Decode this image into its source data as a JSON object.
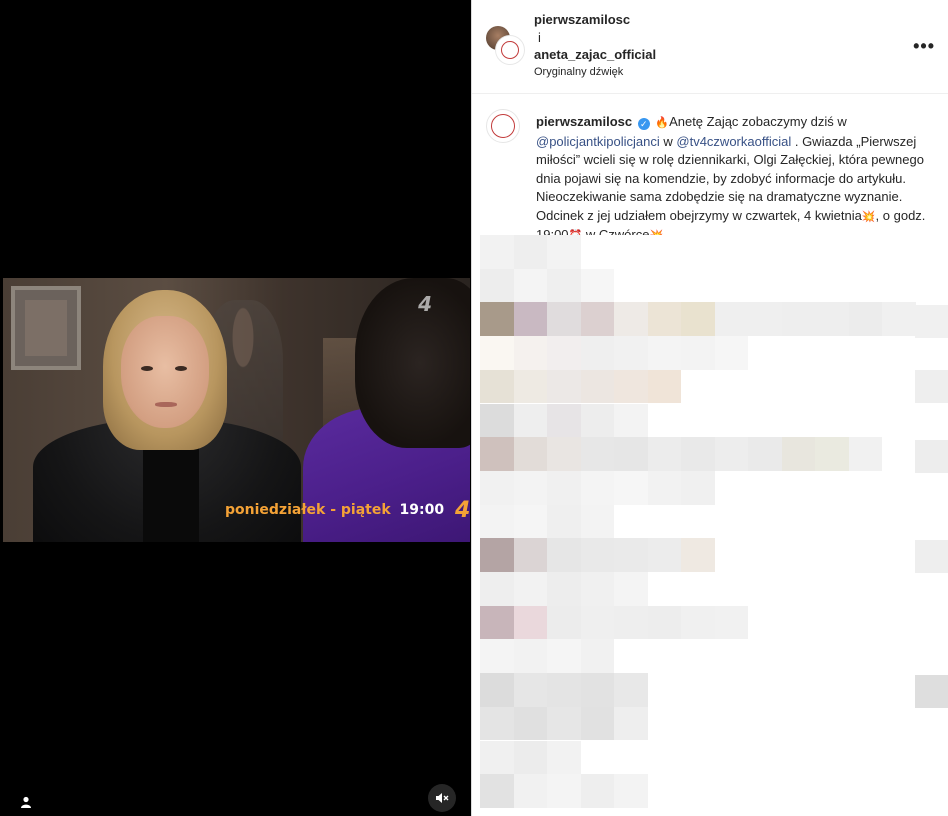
{
  "media": {
    "tv_logo": "4",
    "schedule_days": "poniedziałek - piątek",
    "schedule_time": "19:00",
    "schedule_channel": "4"
  },
  "header": {
    "user1": "pierwszamilosc",
    "and": "i",
    "user2": "aneta_zajac_official",
    "audio": "Oryginalny dźwięk",
    "more": "•••"
  },
  "caption": {
    "username": "pierwszamilosc",
    "text_1": "Anetę Zając zobaczymy dziś w",
    "mention_1": "@policjantkipolicjanci",
    "text_2": " w ",
    "mention_2": "@tv4czworkaofficial",
    "text_3": " . Gwiazda „Pierwszej miłości” wcieli się w rolę dziennikarki, Olgi Załęckiej, która pewnego dnia pojawi się na komendzie, by zdobyć informacje do artykułu. Nieoczekiwanie sama zdobędzie się na dramatyczne wyznanie. Odcinek z jej udziałem obejrzymy w czwartek, 4 kwietnia",
    "text_4": ", o godz. 19:00",
    "text_5": " w Czwórce"
  },
  "colors": {
    "accent_orange": "#f4a236",
    "mention_blue": "#385185",
    "verified_blue": "#3897f0"
  }
}
